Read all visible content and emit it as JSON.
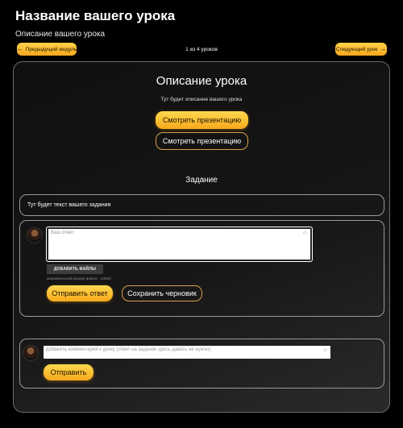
{
  "header": {
    "title": "Название вашего урока",
    "subtitle": "Описание вашего урока"
  },
  "navigation": {
    "prev_label": "Предыдущий модуль",
    "next_label": "Следующий урок",
    "counter": "1 из 4 уроков"
  },
  "lesson": {
    "title": "Описание урока",
    "description": "Тут будет описание вашего урока",
    "presentation_button_primary": "Смотреть презентацию",
    "presentation_button_secondary": "Смотреть презентацию"
  },
  "task": {
    "heading": "Задание",
    "text": "Тут будет текст вашего задания"
  },
  "answer_form": {
    "placeholder": "Ваш ответ",
    "upload_label": "ДОБАВИТЬ ФАЙЛЫ",
    "upload_hint": "максимальный размер файла - 100мб",
    "submit_label": "Отправить ответ",
    "draft_label": "Сохранить черновик"
  },
  "comment_form": {
    "placeholder": "добавить комментарий к уроку (ответ на задание здесь давать не нужно)",
    "send_label": "Отправить"
  },
  "icons": {
    "prev": "arrow-left-icon",
    "next": "arrow-right-icon",
    "emoji": "emoji-icon"
  },
  "colors": {
    "accent": "#f7a81b",
    "accent_light": "#ffd84f",
    "background": "#000000",
    "card_border": "#9a9a9a"
  }
}
